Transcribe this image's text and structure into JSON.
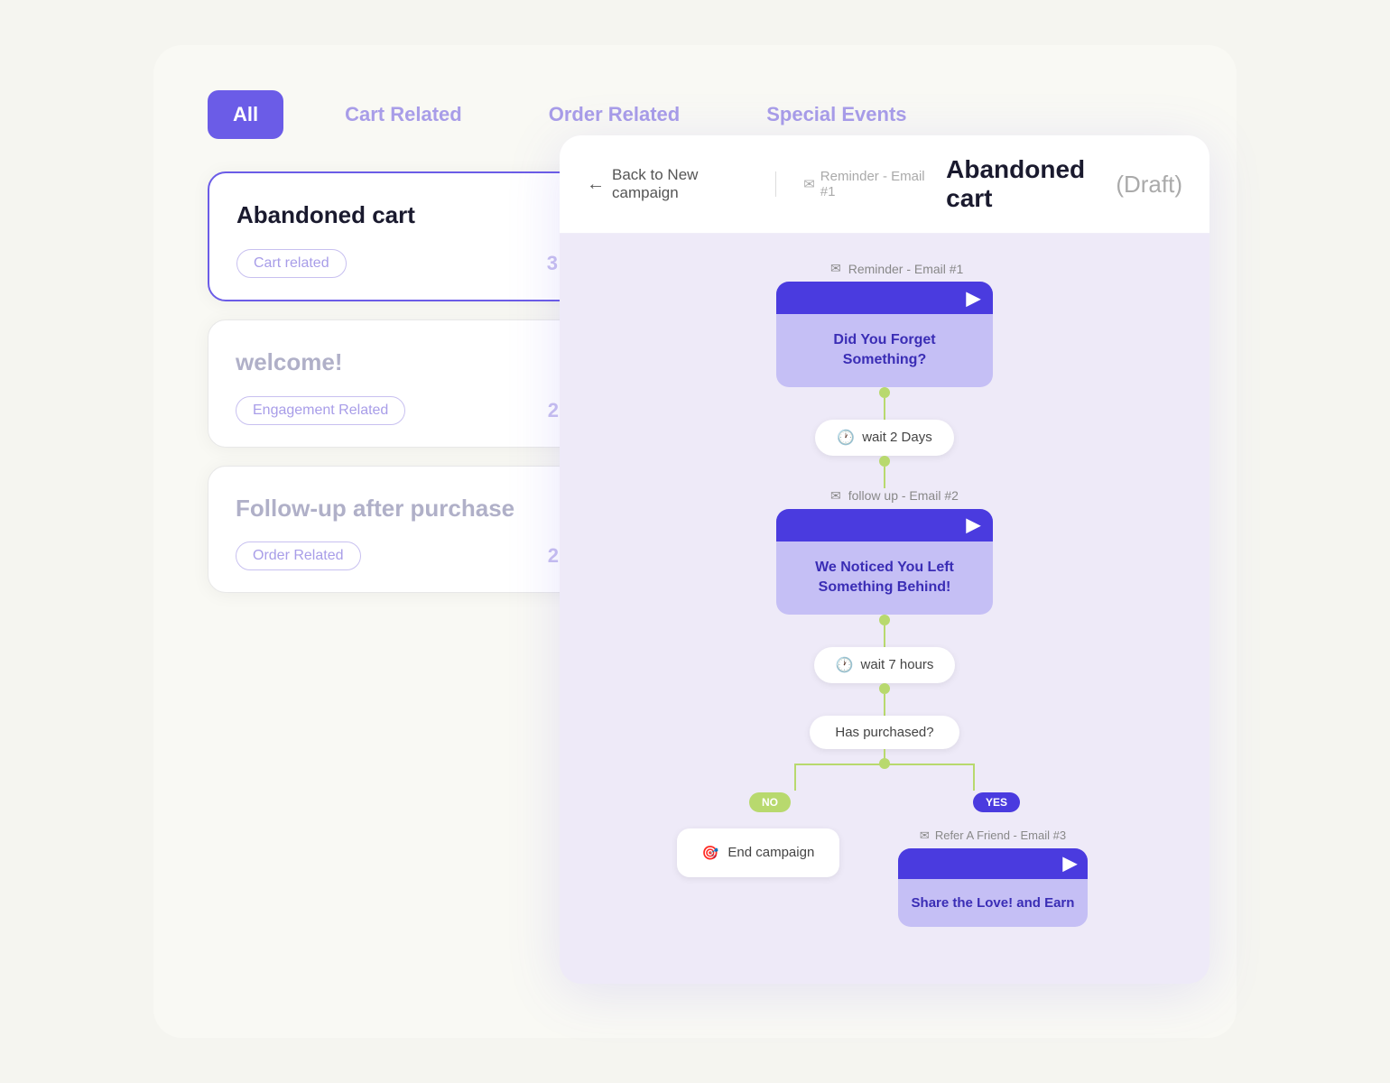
{
  "tabs": [
    {
      "id": "all",
      "label": "All",
      "active": true
    },
    {
      "id": "cart",
      "label": "Cart Related",
      "active": false
    },
    {
      "id": "order",
      "label": "Order Related",
      "active": false
    },
    {
      "id": "special",
      "label": "Special Events",
      "active": false
    }
  ],
  "cards": [
    {
      "id": "abandoned-cart",
      "title": "Abandoned cart",
      "tag": "Cart related",
      "count": "3",
      "active": true,
      "dimmed": false
    },
    {
      "id": "welcome",
      "title": "welcome!",
      "tag": "Engagement Related",
      "count": "2",
      "active": false,
      "dimmed": true
    },
    {
      "id": "follow-up",
      "title": "Follow-up after purchase",
      "tag": "Order Related",
      "count": "2",
      "active": false,
      "dimmed": true
    }
  ],
  "flow": {
    "back_label": "Back to New campaign",
    "header_email": "Reminder - Email #1",
    "title": "Abandoned cart",
    "title_draft": "(Draft)",
    "email1": {
      "label": "Reminder - Email #1",
      "body": "Did You Forget Something?"
    },
    "wait1": "wait 2 Days",
    "email2": {
      "label": "follow up - Email #2",
      "body": "We Noticed You Left Something Behind!"
    },
    "wait2": "wait 7 hours",
    "decision": "Has purchased?",
    "branch_no": "NO",
    "branch_yes": "YES",
    "end_campaign": "End campaign",
    "email3": {
      "label": "Refer A Friend - Email #3",
      "body": "Share the Love! and Earn"
    }
  }
}
